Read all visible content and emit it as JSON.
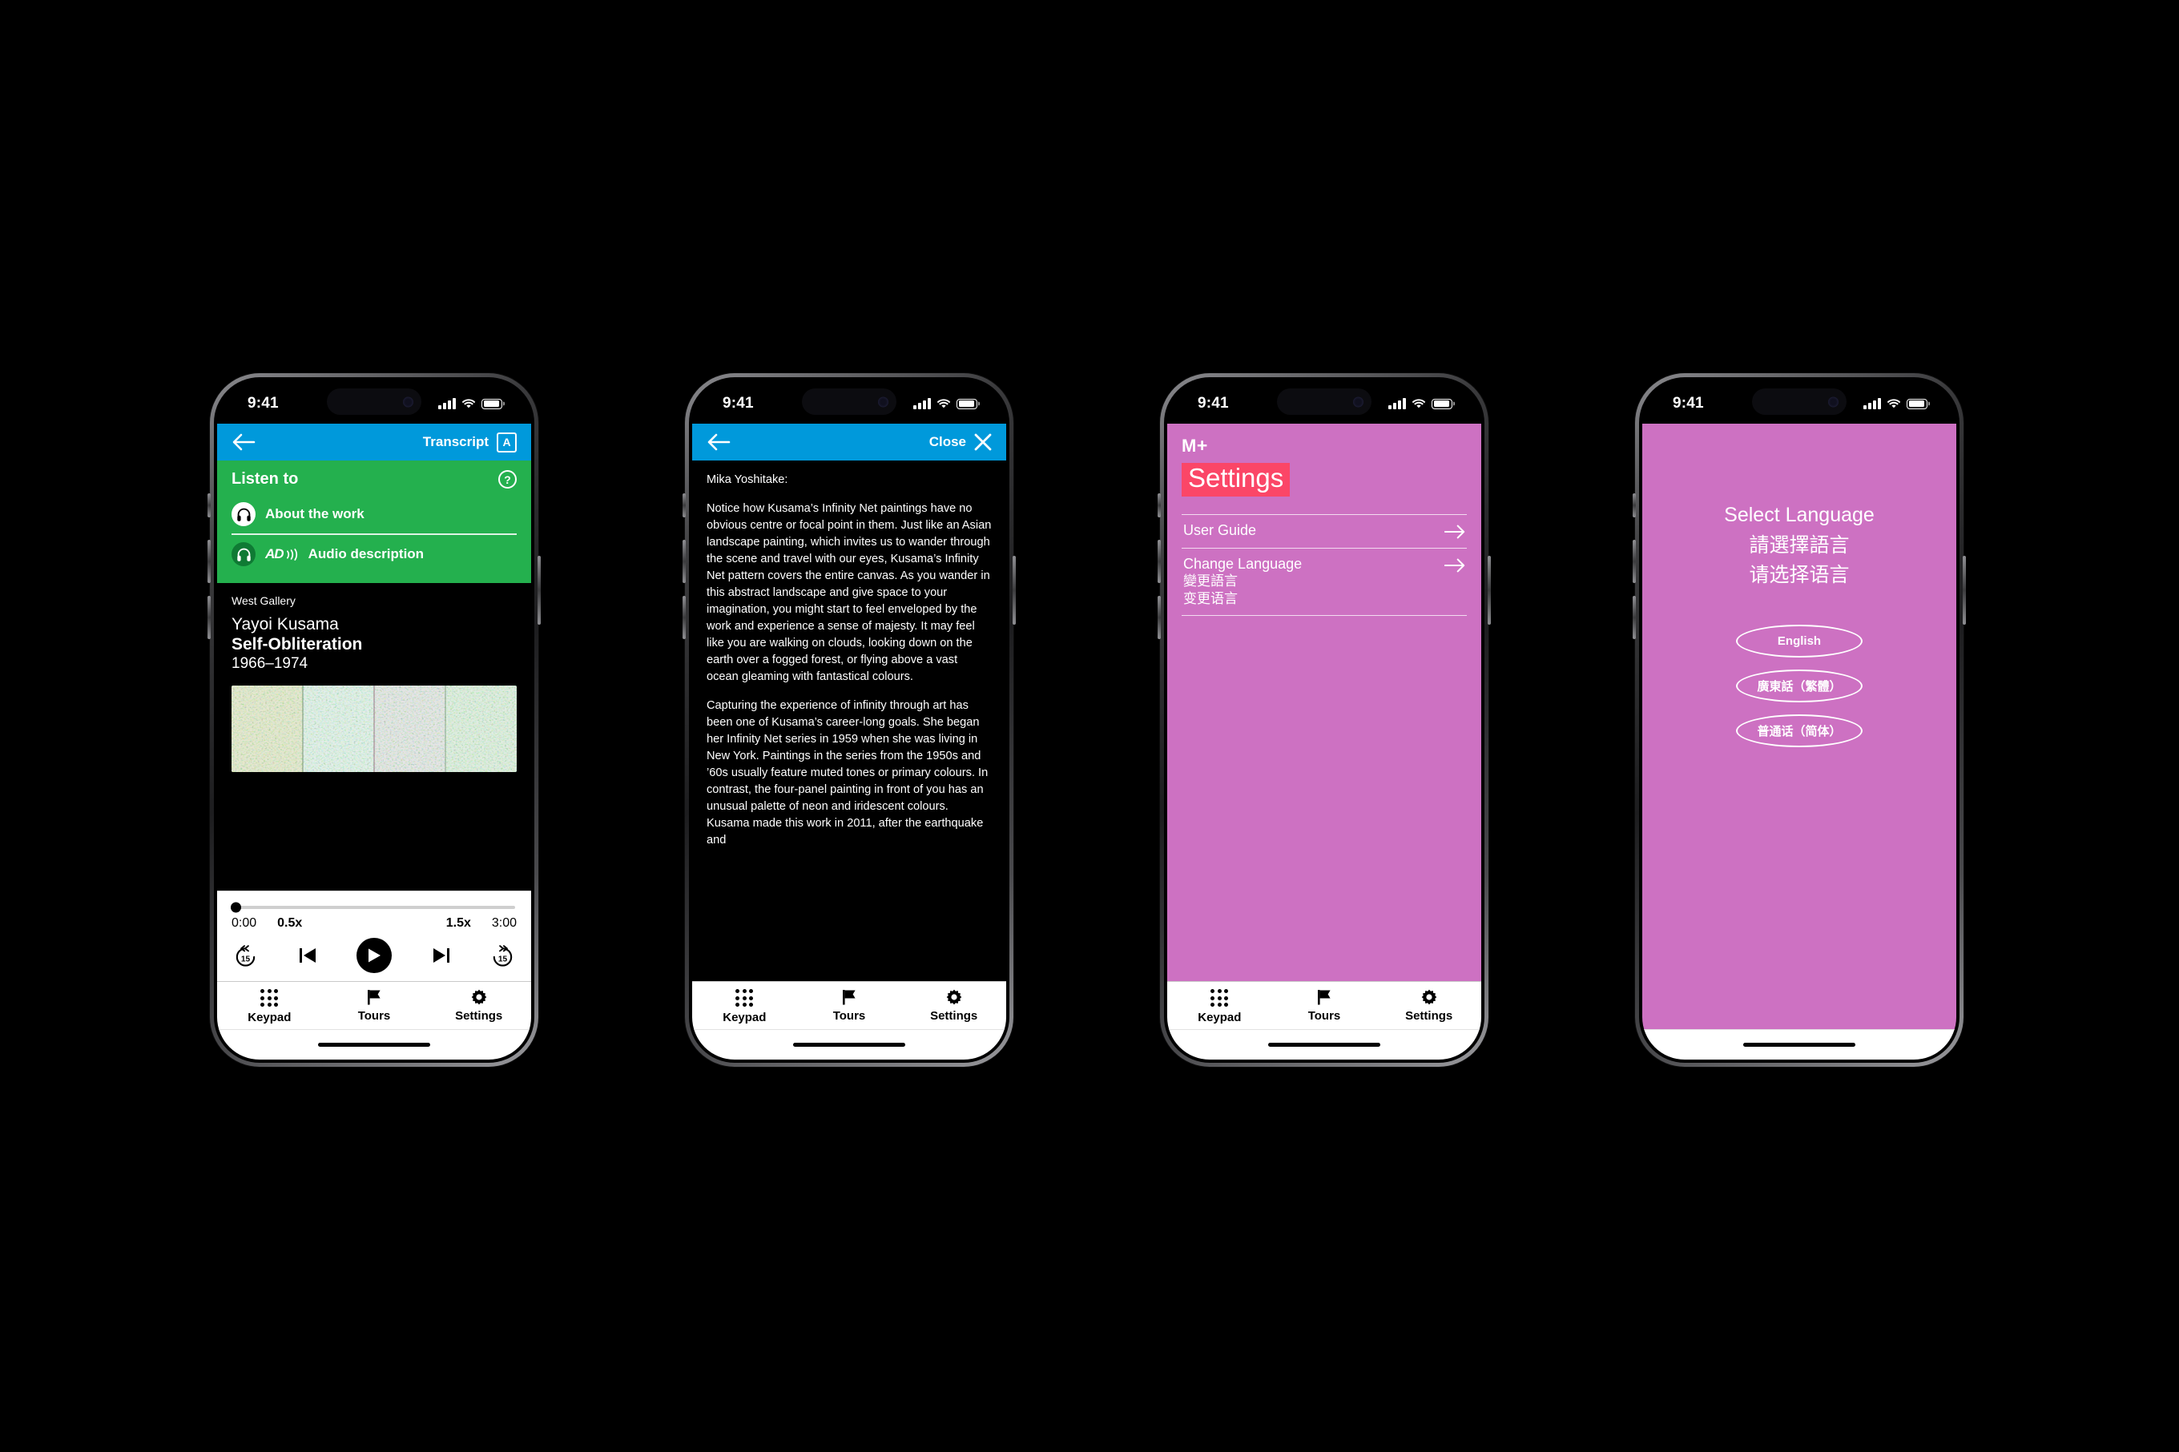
{
  "meta": {
    "background_color": "#000000",
    "accent_blue": "#0099DB",
    "accent_green": "#24B04E",
    "accent_pink": "#CD71C2",
    "accent_red": "#FB4667"
  },
  "status_bar": {
    "time": "9:41",
    "cellular_icon": "cellular-bars-icon",
    "wifi_icon": "wifi-icon",
    "battery_icon": "battery-icon"
  },
  "tabbar": {
    "items": [
      {
        "label": "Keypad",
        "icon": "keypad-dots-icon"
      },
      {
        "label": "Tours",
        "icon": "flag-icon"
      },
      {
        "label": "Settings",
        "icon": "gear-icon"
      }
    ]
  },
  "phone1": {
    "navbar": {
      "back_icon": "back-arrow-icon",
      "transcript_label": "Transcript",
      "audio_badge": "A"
    },
    "listen": {
      "title": "Listen to",
      "help_icon": "question-mark-icon",
      "rows": [
        {
          "label": "About the work",
          "icon": "headphones-icon",
          "badge": ""
        },
        {
          "label": "Audio description",
          "icon": "headphones-ad-icon",
          "badge": "AD"
        }
      ]
    },
    "work": {
      "gallery": "West Gallery",
      "artist": "Yayoi Kusama",
      "title": "Self-Obliteration",
      "date": "1966–1974",
      "thumbnail_alt": "infinity-net-painting-thumbnail"
    },
    "player": {
      "progress_percent": 0,
      "current_time": "0:00",
      "speed_slow": "0.5x",
      "speed_fast": "1.5x",
      "duration": "3:00",
      "controls": [
        "rewind-15-icon",
        "skip-previous-icon",
        "play-icon",
        "skip-next-icon",
        "forward-15-icon"
      ]
    }
  },
  "phone2": {
    "navbar": {
      "back_icon": "back-arrow-icon",
      "close_label": "Close",
      "close_icon": "close-x-icon"
    },
    "transcript": {
      "speaker": "Mika Yoshitake:",
      "paragraphs": [
        "Notice how Kusama’s Infinity Net paintings have no obvious centre or focal point in them. Just like an Asian landscape painting, which invites us to wander through the scene and travel with our eyes, Kusama’s Infinity Net pattern covers the entire canvas. As you wander in this abstract landscape and give space to your imagination, you might start to feel enveloped by the work and experience a sense of majesty. It may feel like you are walking on clouds, looking down on the earth over a fogged forest, or flying above a vast ocean gleaming with fantastical colours.",
        "Capturing the experience of infinity through art has been one of Kusama’s career-long goals. She began her Infinity Net series in 1959 when she was living in New York. Paintings in the series from the 1950s and ’60s usually feature muted tones or primary colours. In contrast, the four-panel painting in front of you has an unusual palette of neon and iridescent colours. Kusama made this work in 2011, after the earthquake and"
      ]
    }
  },
  "phone3": {
    "logo": {
      "letter": "M",
      "plus": "+"
    },
    "title": "Settings",
    "rows": [
      {
        "en": "User Guide",
        "cn_traditional": "",
        "cn_simplified": "",
        "arrow_icon": "arrow-right-icon"
      },
      {
        "en": "Change Language",
        "cn_traditional": "變更語言",
        "cn_simplified": "变更语言",
        "arrow_icon": "arrow-right-icon"
      }
    ]
  },
  "phone4": {
    "heading_en": "Select Language",
    "heading_tc": "請選擇語言",
    "heading_sc": "请选择语言",
    "options": [
      {
        "label": "English"
      },
      {
        "label": "廣東話（繁體）"
      },
      {
        "label": "普通话（简体）"
      }
    ]
  }
}
